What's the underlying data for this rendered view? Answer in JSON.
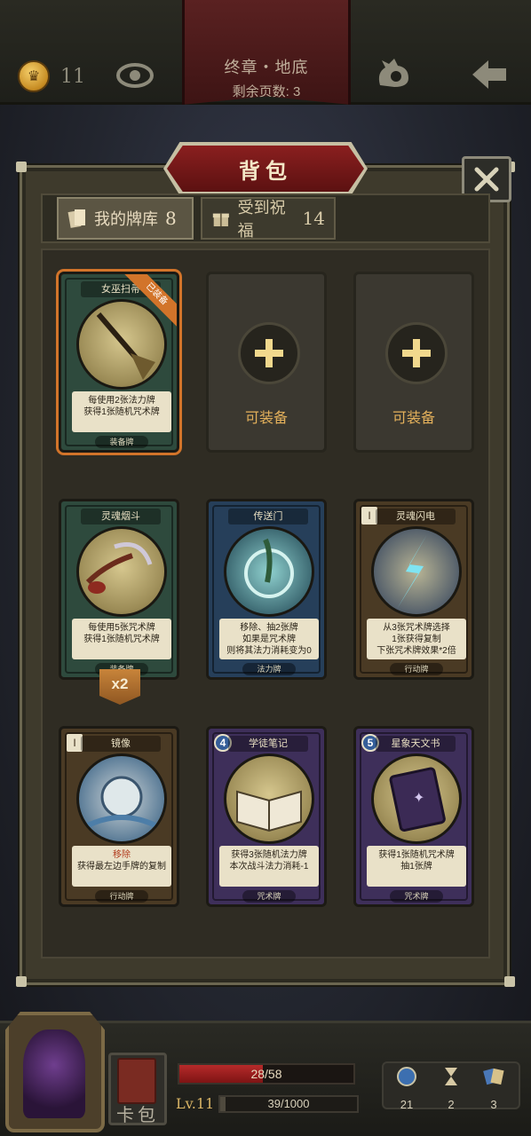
{
  "header": {
    "coins": "11",
    "chapter": "终章・地底",
    "pages_left": "剩余页数: 3"
  },
  "panel": {
    "title": "背包",
    "tabs": [
      {
        "label": "我的牌库",
        "count": "8"
      },
      {
        "label": "受到祝福",
        "count": "14"
      }
    ]
  },
  "cards": [
    {
      "name": "女巫扫帚",
      "desc1": "每使用2张法力牌",
      "desc2": "获得1张随机咒术牌",
      "desc3": "",
      "type": "装备牌",
      "ribbon": "已装备",
      "badge": ""
    },
    {
      "name": "灵魂烟斗",
      "desc1": "每使用5张咒术牌",
      "desc2": "获得1张随机咒术牌",
      "desc3": "",
      "type": "装备牌",
      "ribbon": "",
      "badge": ""
    },
    {
      "name": "传送门",
      "desc1": "移除、抽2张牌",
      "desc2": "如果是咒术牌",
      "desc3": "则将其法力消耗变为0",
      "type": "法力牌",
      "ribbon": "",
      "badge": ""
    },
    {
      "name": "灵魂闪电",
      "desc1": "从3张咒术牌选择",
      "desc2": "1张获得复制",
      "desc3": "下张咒术牌效果*2倍",
      "type": "行动牌",
      "ribbon": "",
      "badge": "I"
    },
    {
      "name": "镜像",
      "desc1": "移除",
      "desc2": "获得最左边手牌的复制",
      "desc3": "",
      "type": "行动牌",
      "ribbon": "",
      "badge": "I"
    },
    {
      "name": "学徒笔记",
      "desc1": "获得3张随机法力牌",
      "desc2": "本次战斗法力消耗-1",
      "desc3": "",
      "type": "咒术牌",
      "ribbon": "",
      "badge": "4"
    },
    {
      "name": "星象天文书",
      "desc1": "获得1张随机咒术牌",
      "desc2": "抽1张牌",
      "desc3": "",
      "type": "咒术牌",
      "ribbon": "",
      "badge": "5"
    }
  ],
  "empty_slot_label": "可装备",
  "multiplier": "x2",
  "bottom": {
    "deck_label": "卡包",
    "hp": "28/58",
    "hp_fraction": 0.48,
    "level": "Lv.11",
    "xp": "39/1000",
    "xp_fraction": 0.04,
    "resources": [
      "21",
      "2",
      "3"
    ]
  },
  "colors": {
    "accent_gold": "#e3b05b",
    "hp_red": "#b62a2a",
    "title_red": "#8a1f1f"
  }
}
